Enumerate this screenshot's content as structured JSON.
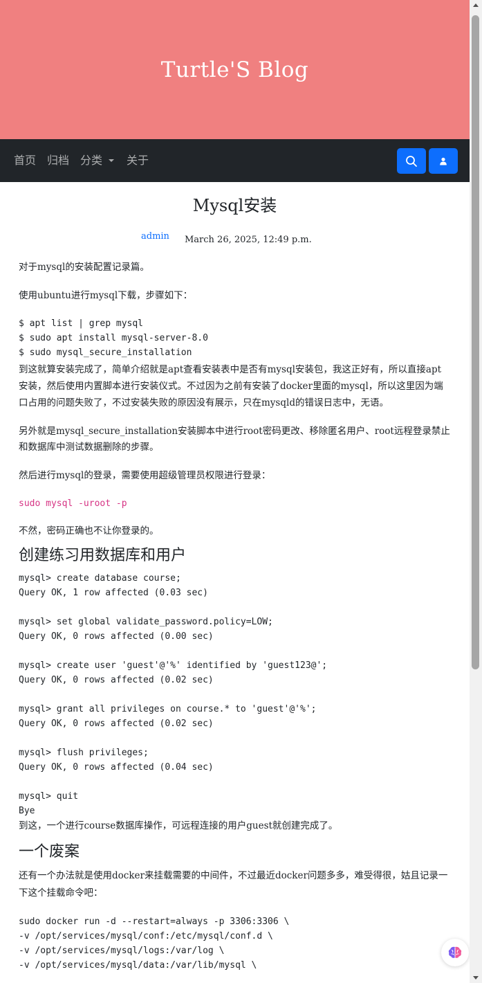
{
  "blog": {
    "title": "Turtle'S Blog"
  },
  "nav": {
    "home": "首页",
    "archive": "归档",
    "category": "分类",
    "about": "关于"
  },
  "icons": {
    "search": "search-icon",
    "user": "user-icon",
    "assistant": "brain-icon"
  },
  "colors": {
    "hero": "#f08080",
    "navbar": "#212529",
    "button": "#0d6efd",
    "link": "#0d6efd",
    "inline_code": "#d63384"
  },
  "post": {
    "title": "Mysql安装",
    "author": "admin",
    "date": "March 26, 2025, 12:49 p.m.",
    "p1": "对于mysql的安装配置记录篇。",
    "p2": "使用ubuntu进行mysql下载，步骤如下：",
    "code1": "$ apt list | grep mysql\n$ sudo apt install mysql-server-8.0\n$ sudo mysql_secure_installation",
    "p3": "到这就算安装完成了，简单介绍就是apt查看安装表中是否有mysql安装包，我这正好有，所以直接apt安装，然后使用内置脚本进行安装仪式。不过因为之前有安装了docker里面的mysql，所以这里因为端口占用的问题失败了，不过安装失败的原因没有展示，只在mysqld的错误日志中，无语。",
    "p4": "另外就是mysql_secure_installation安装脚本中进行root密码更改、移除匿名用户、root远程登录禁止和数据库中测试数据删除的步骤。",
    "p5": "然后进行mysql的登录，需要使用超级管理员权限进行登录：",
    "inline_code": "sudo mysql -uroot -p",
    "p6": "不然，密码正确也不让你登录的。",
    "h2_1": "创建练习用数据库和用户",
    "code2": "mysql> create database course;\nQuery OK, 1 row affected (0.03 sec)\n\nmysql> set global validate_password.policy=LOW;\nQuery OK, 0 rows affected (0.00 sec)\n\nmysql> create user 'guest'@'%' identified by 'guest123@';\nQuery OK, 0 rows affected (0.02 sec)\n\nmysql> grant all privileges on course.* to 'guest'@'%';\nQuery OK, 0 rows affected (0.02 sec)\n\nmysql> flush privileges;\nQuery OK, 0 rows affected (0.04 sec)\n\nmysql> quit\nBye",
    "p7": "到这，一个进行course数据库操作，可远程连接的用户guest就创建完成了。",
    "h2_2": "一个废案",
    "p8": "还有一个办法就是使用docker来挂载需要的中间件，不过最近docker问题多多，难受得很，姑且记录一下这个挂载命令吧：",
    "code3": "sudo docker run -d --restart=always -p 3306:3306 \\\n-v /opt/services/mysql/conf:/etc/mysql/conf.d \\\n-v /opt/services/mysql/logs:/var/log \\\n-v /opt/services/mysql/data:/var/lib/mysql \\"
  }
}
